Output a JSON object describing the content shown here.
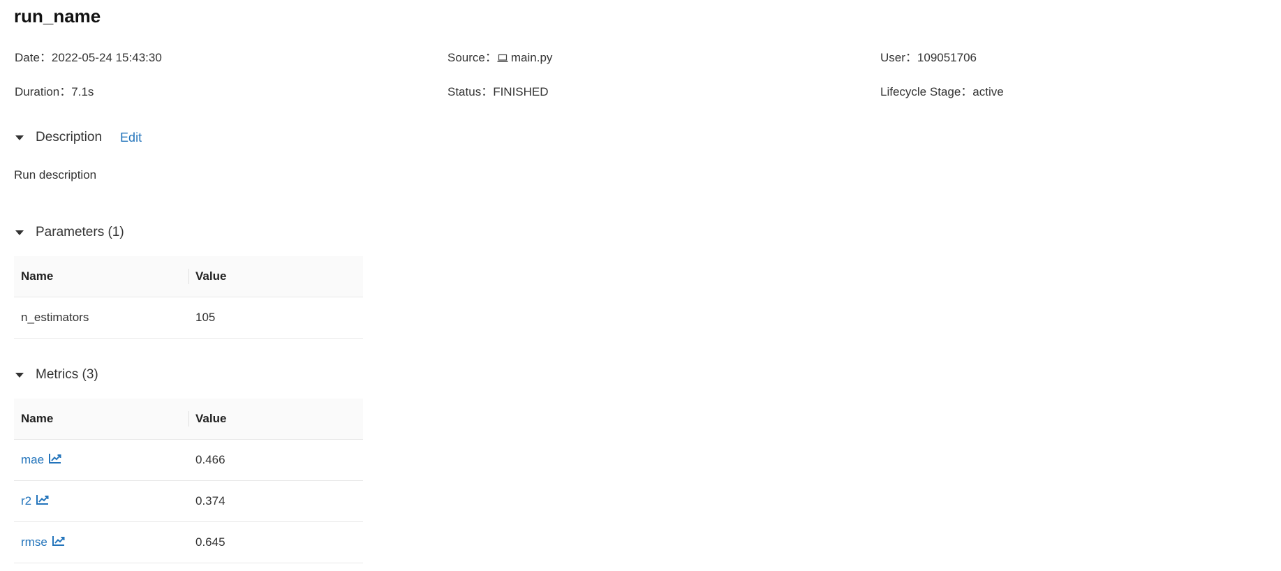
{
  "run": {
    "title": "run_name",
    "date_label": "Date：",
    "date": "2022-05-24 15:43:30",
    "source_label": "Source：",
    "source_icon": "laptop-icon",
    "source": "main.py",
    "user_label": "User：",
    "user": "109051706",
    "duration_label": "Duration：",
    "duration": "7.1s",
    "status_label": "Status：",
    "status": "FINISHED",
    "lifecycle_label": "Lifecycle Stage：",
    "lifecycle": "active"
  },
  "description": {
    "header": "Description",
    "edit_label": "Edit",
    "text": "Run description"
  },
  "parameters": {
    "header": "Parameters (1)",
    "columns": [
      "Name",
      "Value"
    ],
    "rows": [
      {
        "name": "n_estimators",
        "value": "105"
      }
    ]
  },
  "metrics": {
    "header": "Metrics (3)",
    "columns": [
      "Name",
      "Value"
    ],
    "rows": [
      {
        "name": "mae",
        "value": "0.466",
        "icon": "line-chart-icon"
      },
      {
        "name": "r2",
        "value": "0.374",
        "icon": "line-chart-icon"
      },
      {
        "name": "rmse",
        "value": "0.645",
        "icon": "line-chart-icon"
      }
    ]
  },
  "colors": {
    "link": "#2374bb",
    "header_bg": "#fafafa"
  }
}
